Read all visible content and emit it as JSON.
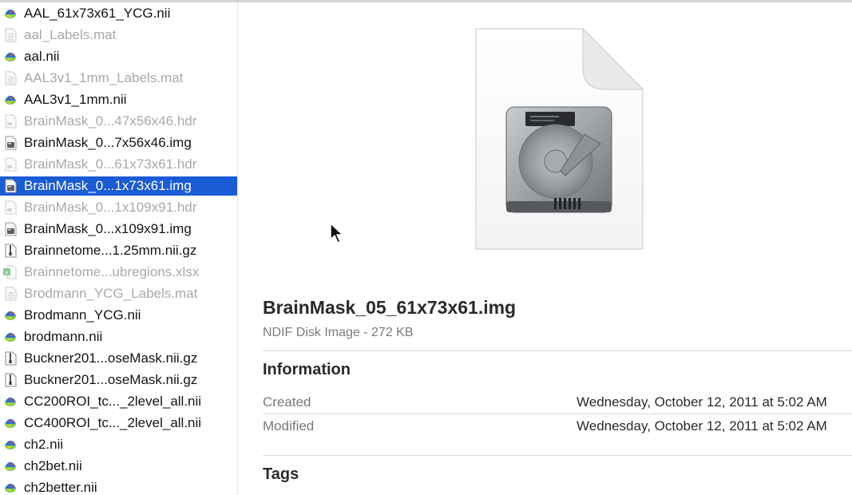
{
  "sidebar": {
    "selected_index": 8,
    "items": [
      {
        "label": "AAL_61x73x61_YCG.nii",
        "icon": "nifti-brain-icon",
        "dim": false
      },
      {
        "label": "aal_Labels.mat",
        "icon": "spreadsheet-file-icon",
        "dim": true
      },
      {
        "label": "aal.nii",
        "icon": "nifti-brain-icon",
        "dim": false
      },
      {
        "label": "AAL3v1_1mm_Labels.mat",
        "icon": "spreadsheet-file-icon",
        "dim": true
      },
      {
        "label": "AAL3v1_1mm.nii",
        "icon": "nifti-brain-icon",
        "dim": false
      },
      {
        "label": "BrainMask_0...47x56x46.hdr",
        "icon": "header-file-icon",
        "dim": true
      },
      {
        "label": "BrainMask_0...7x56x46.img",
        "icon": "disk-image-file-icon",
        "dim": false
      },
      {
        "label": "BrainMask_0...61x73x61.hdr",
        "icon": "header-file-icon",
        "dim": true
      },
      {
        "label": "BrainMask_0...1x73x61.img",
        "icon": "disk-image-file-icon",
        "dim": false
      },
      {
        "label": "BrainMask_0...1x109x91.hdr",
        "icon": "header-file-icon",
        "dim": true
      },
      {
        "label": "BrainMask_0...x109x91.img",
        "icon": "disk-image-file-icon",
        "dim": false
      },
      {
        "label": "Brainnetome...1.25mm.nii.gz",
        "icon": "zip-archive-icon",
        "dim": false
      },
      {
        "label": "Brainnetome...ubregions.xlsx",
        "icon": "excel-file-icon",
        "dim": true
      },
      {
        "label": "Brodmann_YCG_Labels.mat",
        "icon": "spreadsheet-file-icon",
        "dim": true
      },
      {
        "label": "Brodmann_YCG.nii",
        "icon": "nifti-brain-icon",
        "dim": false
      },
      {
        "label": "brodmann.nii",
        "icon": "nifti-brain-icon",
        "dim": false
      },
      {
        "label": "Buckner201...oseMask.nii.gz",
        "icon": "zip-archive-icon",
        "dim": false
      },
      {
        "label": "Buckner201...oseMask.nii.gz",
        "icon": "zip-archive-icon",
        "dim": false
      },
      {
        "label": "CC200ROI_tc..._2level_all.nii",
        "icon": "nifti-brain-icon",
        "dim": false
      },
      {
        "label": "CC400ROI_tc..._2level_all.nii",
        "icon": "nifti-brain-icon",
        "dim": false
      },
      {
        "label": "ch2.nii",
        "icon": "nifti-brain-icon",
        "dim": false
      },
      {
        "label": "ch2bet.nii",
        "icon": "nifti-brain-icon",
        "dim": false
      },
      {
        "label": "ch2better.nii",
        "icon": "nifti-brain-icon",
        "dim": false
      }
    ]
  },
  "preview": {
    "icon": "hard-drive-disk-image-icon",
    "file_name": "BrainMask_05_61x73x61.img",
    "kind_and_size": "NDIF Disk Image - 272 KB",
    "information_heading": "Information",
    "created_label": "Created",
    "created_value": "Wednesday, October 12, 2011 at 5:02 AM",
    "modified_label": "Modified",
    "modified_value": "Wednesday, October 12, 2011 at 5:02 AM",
    "tags_heading": "Tags"
  },
  "colors": {
    "selection": "#1a5bd6",
    "dim_text": "#a9a9a9",
    "secondary_text": "#7a7a7a"
  }
}
